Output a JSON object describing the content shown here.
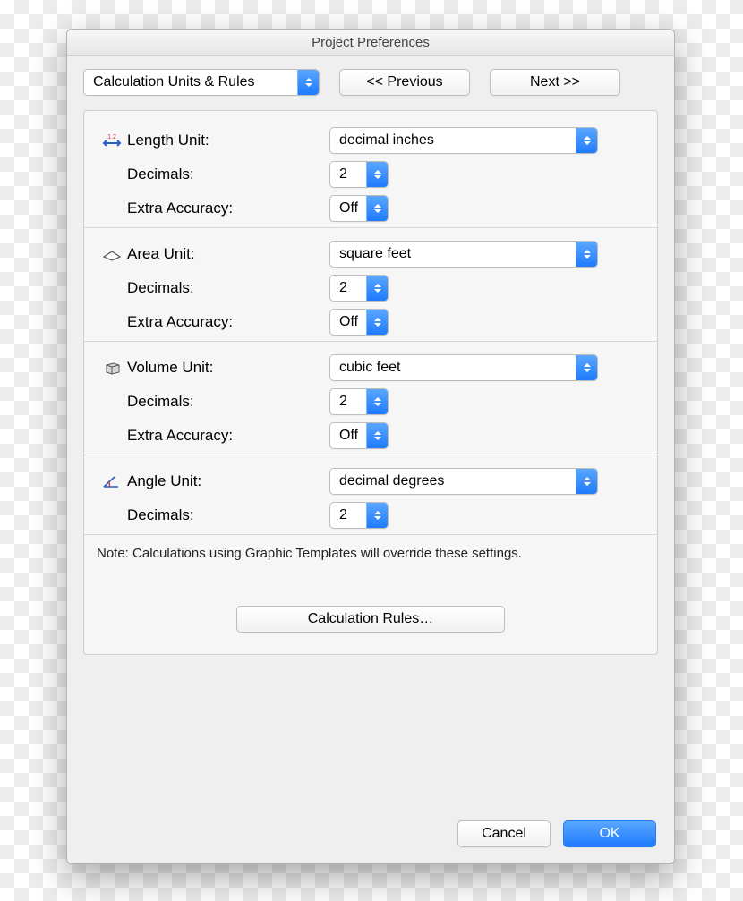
{
  "title": "Project Preferences",
  "category_select": "Calculation Units & Rules",
  "prev_label": "<< Previous",
  "next_label": "Next >>",
  "labels": {
    "decimals": "Decimals:",
    "extra_accuracy": "Extra Accuracy:"
  },
  "length": {
    "label": "Length Unit:",
    "unit": "decimal inches",
    "decimals": "2",
    "extra": "Off"
  },
  "area": {
    "label": "Area Unit:",
    "unit": "square feet",
    "decimals": "2",
    "extra": "Off"
  },
  "volume": {
    "label": "Volume Unit:",
    "unit": "cubic feet",
    "decimals": "2",
    "extra": "Off"
  },
  "angle": {
    "label": "Angle Unit:",
    "unit": "decimal degrees",
    "decimals": "2"
  },
  "note": "Note: Calculations using Graphic Templates will override these settings.",
  "rules_button": "Calculation Rules…",
  "cancel": "Cancel",
  "ok": "OK"
}
